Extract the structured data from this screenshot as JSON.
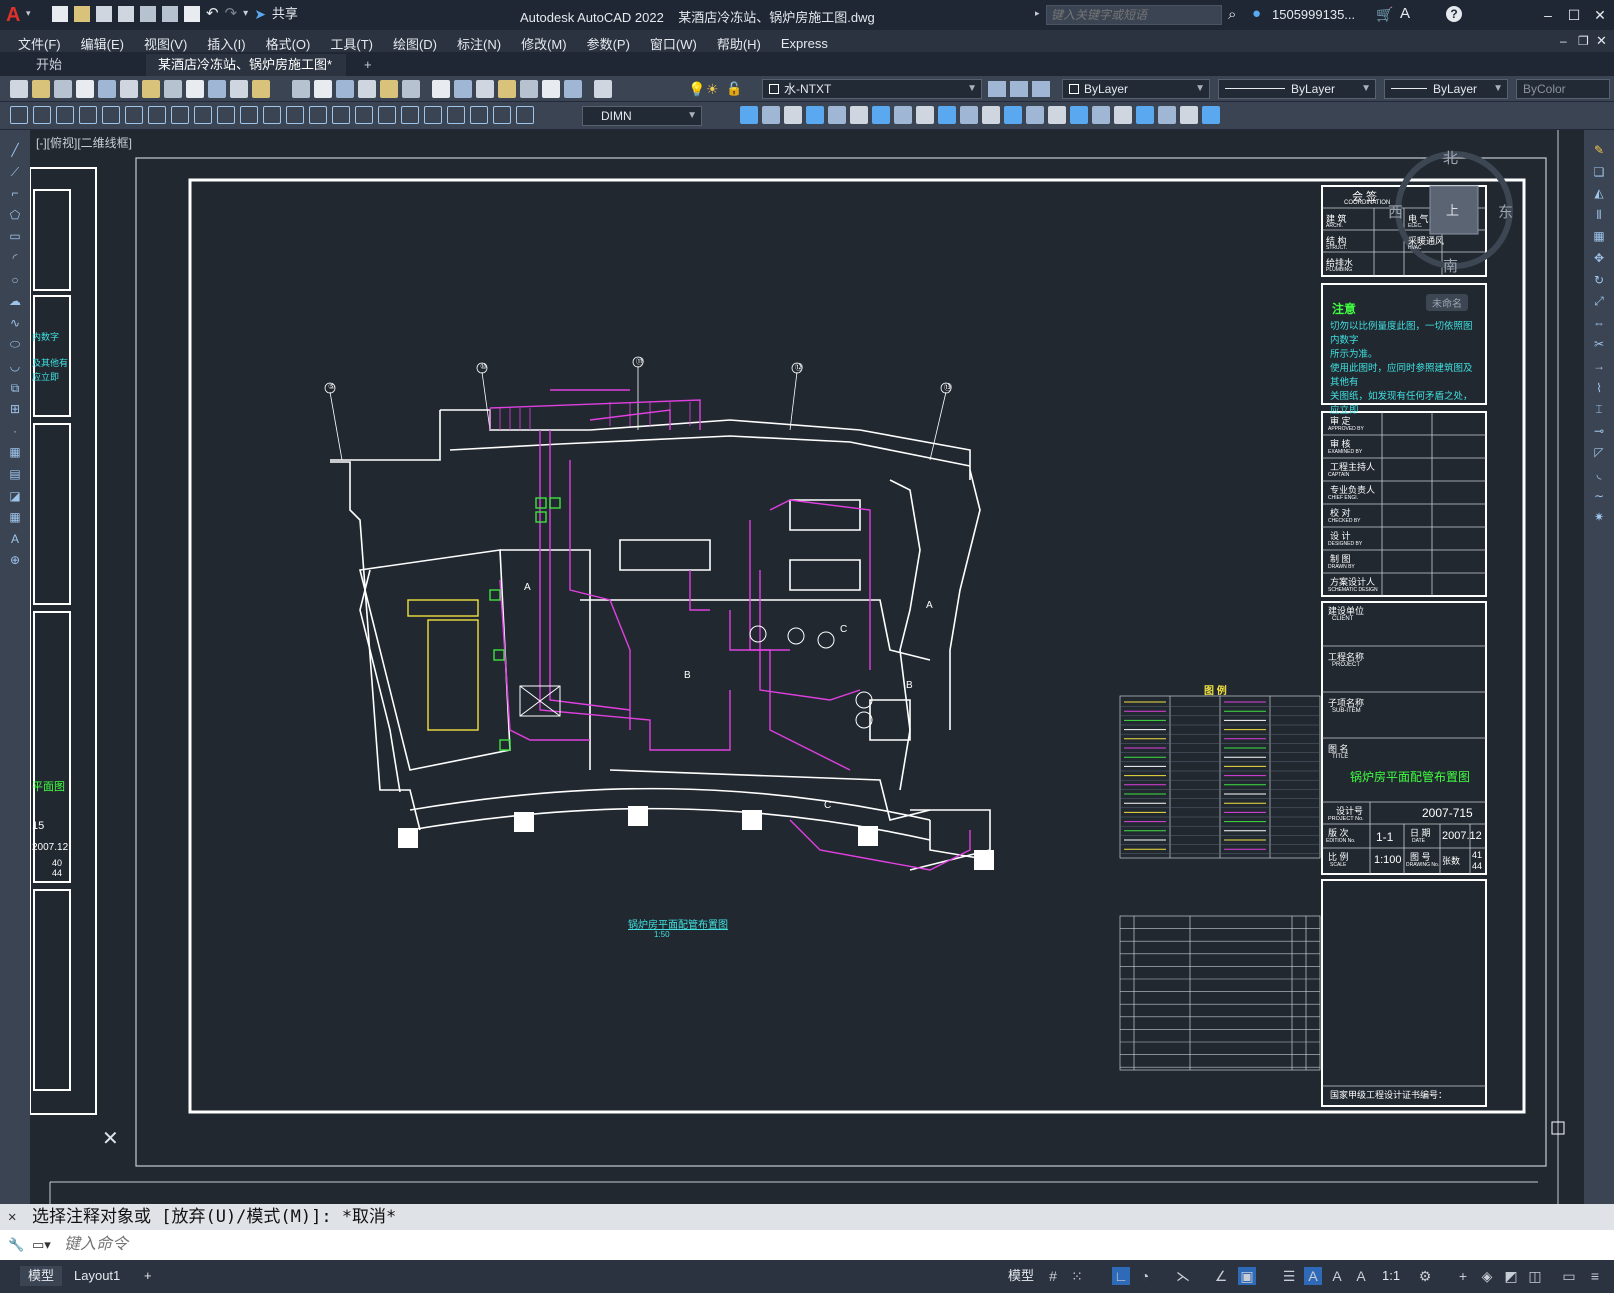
{
  "app": {
    "title": "Autodesk AutoCAD 2022    某酒店冷冻站、锅炉房施工图.dwg",
    "share_label": "共享",
    "search_placeholder": "键入关键字或短语",
    "user": "1505999135...",
    "logo": "A"
  },
  "menu": [
    "文件(F)",
    "编辑(E)",
    "视图(V)",
    "插入(I)",
    "格式(O)",
    "工具(T)",
    "绘图(D)",
    "标注(N)",
    "修改(M)",
    "参数(P)",
    "窗口(W)",
    "帮助(H)",
    "Express"
  ],
  "tabs": {
    "start": "开始",
    "drawing": "某酒店冷冻站、锅炉房施工图*",
    "close": "×",
    "new": "+"
  },
  "toolbar": {
    "layer_value": "水-NTXT",
    "color_value": "ByLayer",
    "linetype_value": "ByLayer",
    "lineweight_value": "ByLayer",
    "plotstyle_value": "ByColor",
    "dimstyle_value": "DIMN"
  },
  "viewport": {
    "label": "[-][俯视][二维线框]",
    "viewcube": {
      "north": "北",
      "south": "南",
      "east": "东",
      "west": "西",
      "top": "上",
      "wcs": "未命名"
    }
  },
  "drawing": {
    "coordination_title": "会 签",
    "coordination_sub": "COORDINATION",
    "coord_rows": [
      {
        "l": "建 筑",
        "le": "ARCHI.",
        "r": "电 气",
        "re": "ELEC."
      },
      {
        "l": "结 构",
        "le": "STRUCT.",
        "r": "采暖通风",
        "re": "HVAC"
      },
      {
        "l": "给排水",
        "le": "PLUMBING",
        "r": "",
        "re": ""
      }
    ],
    "notes_title": "注意",
    "notes_text": [
      "切勿以比例量度此图，一切依照图内数字",
      "所示为准。",
      "使用此图时，应同时参照建筑图及其他有",
      "关图纸，如发现有任何矛盾之处，应立即"
    ],
    "approval_rows": [
      {
        "cn": "审 定",
        "en": "APPROVED BY"
      },
      {
        "cn": "审 核",
        "en": "EXAMINED BY"
      },
      {
        "cn": "工程主持人",
        "en": "CAPTAIN"
      },
      {
        "cn": "专业负责人",
        "en": "CHIEF ENGI."
      },
      {
        "cn": "校 对",
        "en": "CHECKED BY"
      },
      {
        "cn": "设 计",
        "en": "DESIGNED BY"
      },
      {
        "cn": "制 图",
        "en": "DRAWN BY"
      },
      {
        "cn": "方案设计人",
        "en": "SCHEMATIC DESIGN"
      }
    ],
    "client_cn": "建设单位",
    "client_en": "CLIENT",
    "project_cn": "工程名称",
    "project_en": "PROJECT",
    "subitem_cn": "子项名称",
    "subitem_en": "SUB-ITEM",
    "title_cn": "图 名",
    "title_en": "TITLE",
    "sheet_title": "锅炉房平面配管布置图",
    "project_no_label": "设计号",
    "project_no_en": "PROJECT No.",
    "project_no": "2007-715",
    "edition_label": "版 次",
    "edition_en": "EDITION No.",
    "edition": "1-1",
    "date_label": "日 期",
    "date_en": "DATE",
    "date": "2007.12",
    "scale_label": "比 例",
    "scale_en": "SCALE",
    "scale": "1:100",
    "drawing_no_label": "图 号",
    "drawing_no_en": "DRAWING No.",
    "sheet_label": "张数",
    "sheet_a": "41",
    "sheet_b": "44",
    "cert_text": "国家甲级工程设计证书编号：",
    "legend_title": "图 例",
    "plan_title": "锅炉房平面配管布置图",
    "plan_scale": "1:50",
    "left_partial_1": "内数字",
    "left_partial_2": "及其他有",
    "left_partial_3": "应立即",
    "left_partial_title": "平面图",
    "left_partial_no": "15",
    "left_partial_date": "2007.12",
    "left_partial_a": "40",
    "left_partial_b": "44",
    "axis_markers": [
      "⑤",
      "⑩",
      "⑪",
      "⑫",
      "⑬"
    ],
    "room_labels": [
      "A",
      "B",
      "C",
      "A",
      "B",
      "C"
    ]
  },
  "command": {
    "history": "选择注释对象或 [放弃(U)/模式(M)]: *取消*",
    "input_placeholder": "键入命令"
  },
  "status": {
    "model_tab": "模型",
    "layout_tab": "Layout1",
    "add": "+",
    "model_btn": "模型",
    "scale": "1:1"
  }
}
